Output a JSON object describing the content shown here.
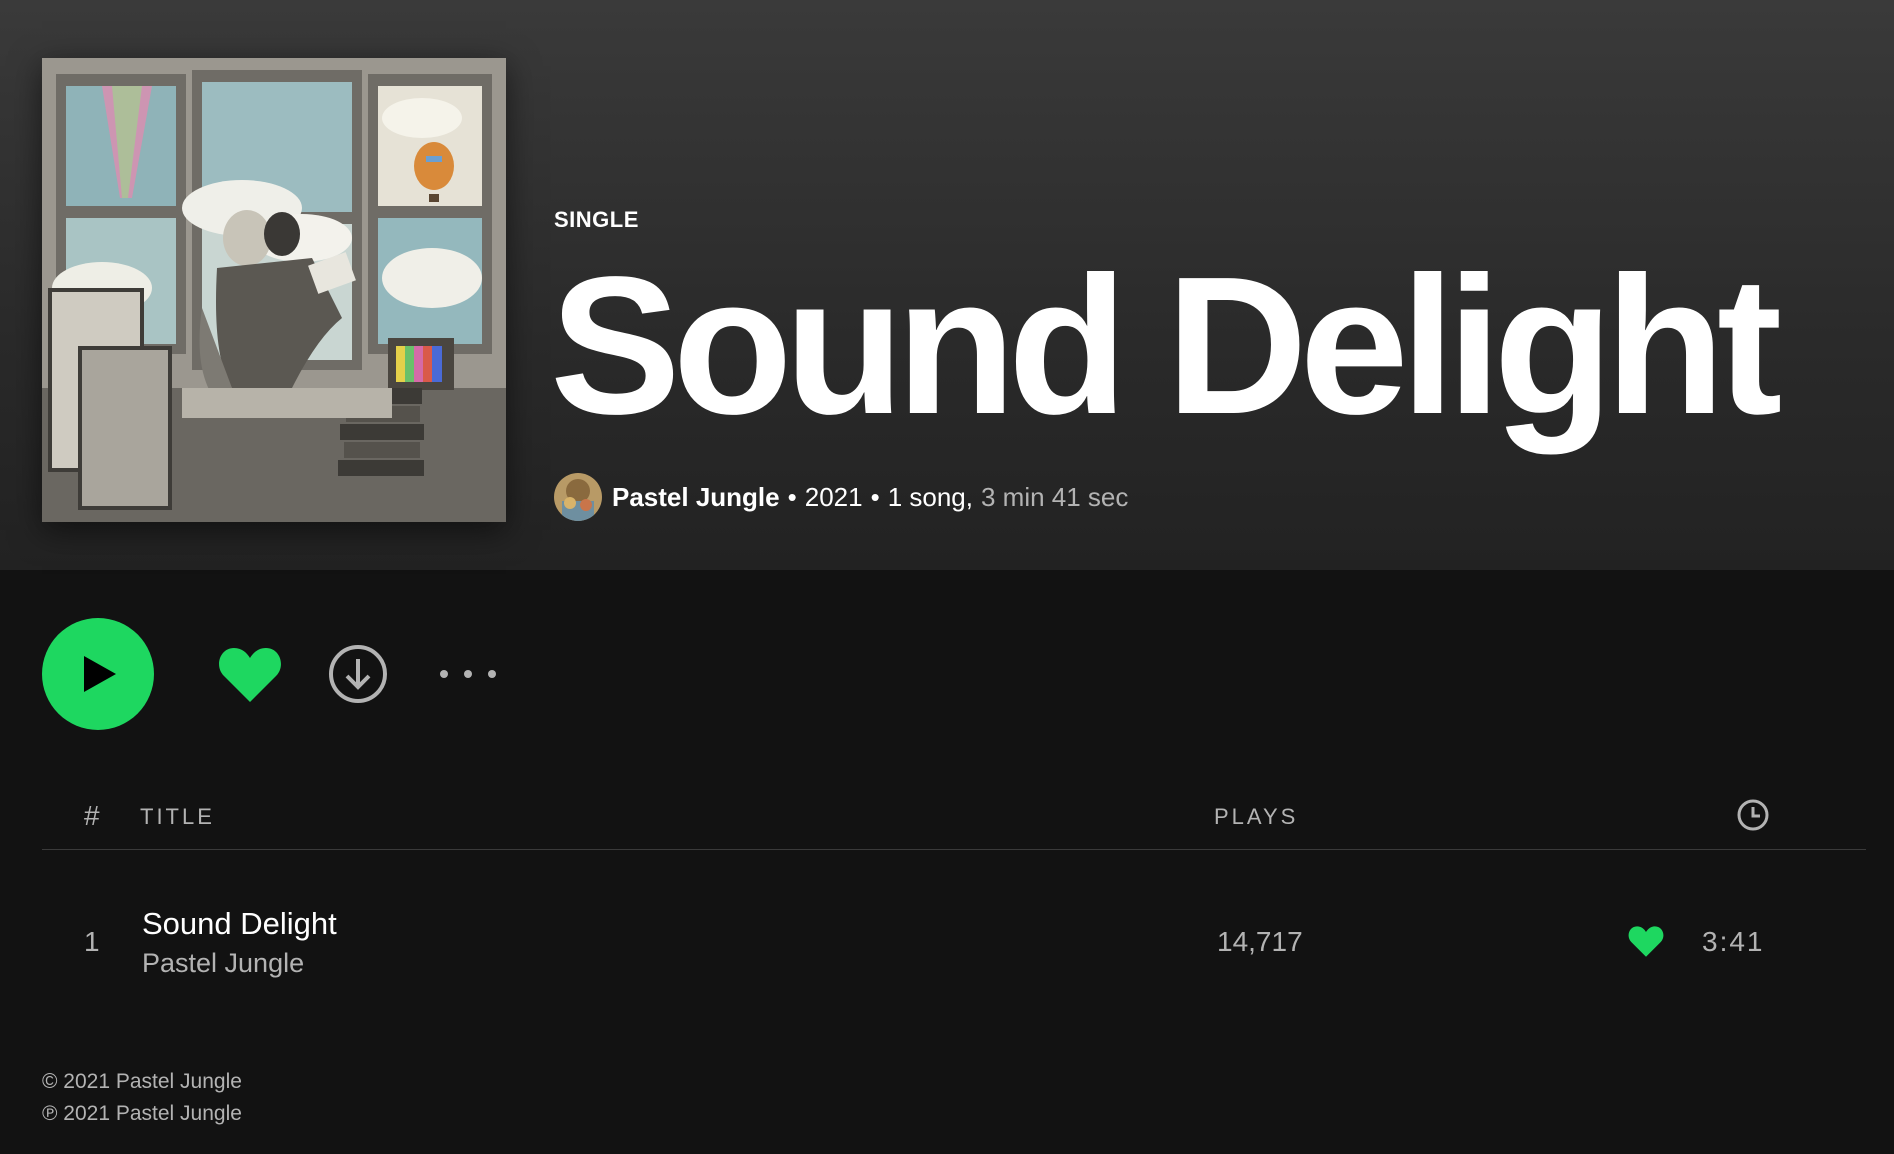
{
  "album": {
    "type": "SINGLE",
    "title": "Sound Delight",
    "artist": "Pastel Jungle",
    "year": "2021",
    "song_count": "1 song,",
    "duration": "3 min 41 sec",
    "separator": "•"
  },
  "actions": {
    "play": "play-icon",
    "like": "heart-icon",
    "download": "download-icon",
    "more": "more-icon"
  },
  "tracklist": {
    "header": {
      "number": "#",
      "title": "TITLE",
      "plays": "PLAYS",
      "duration_icon": "clock-icon"
    },
    "tracks": [
      {
        "number": "1",
        "title": "Sound Delight",
        "artist": "Pastel Jungle",
        "plays": "14,717",
        "liked": true,
        "duration": "3:41"
      }
    ]
  },
  "footer": {
    "copyright": "© 2021 Pastel Jungle",
    "phonographic": "℗ 2021 Pastel Jungle"
  },
  "colors": {
    "accent": "#1ed760",
    "background": "#121212",
    "header_bg": "#2a2a2a",
    "muted_text": "#b3b3b3"
  }
}
